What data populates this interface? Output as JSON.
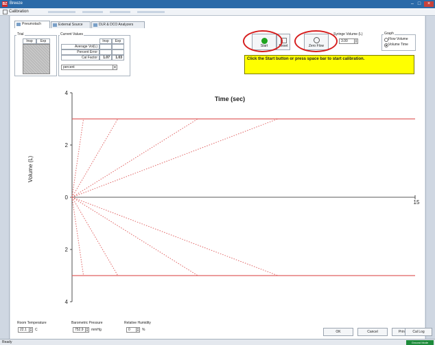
{
  "window": {
    "title": "Breeze",
    "logo": "BZ"
  },
  "menubar": {
    "label": "Calibration"
  },
  "tabs": [
    {
      "label": "Pneumotach",
      "icon": "pneumotach-icon"
    },
    {
      "label": "External Source",
      "icon": "external-source-icon"
    },
    {
      "label": "DLR & DCO Analyzers",
      "icon": "analyzer-icon"
    }
  ],
  "trial": {
    "label": "Trial",
    "insp": "Insp",
    "exp": "Exp"
  },
  "current_values": {
    "label": "Current Values",
    "insp": "Insp",
    "exp": "Exp",
    "rows": [
      {
        "name": "Average Vol(L)",
        "insp": "",
        "exp": ""
      },
      {
        "name": "Percent Error",
        "insp": "",
        "exp": ""
      },
      {
        "name": "Cal Factor",
        "insp": "1.07",
        "exp": "1.03"
      }
    ],
    "select_value": "percent"
  },
  "buttons": {
    "start": "Start",
    "reset": "Reset",
    "zero_flow": "Zero Flow",
    "ok": "OK",
    "cancel": "Cancel",
    "print": "Print",
    "cal_log": "Cal Log"
  },
  "syringe": {
    "label": "Syringe Volume (L)",
    "value": "3.00"
  },
  "graph_options": {
    "label": "Graph",
    "flow_volume": "Flow Volume",
    "volume_time": "Volume Time",
    "selected": "Volume Time"
  },
  "message": "Click the Start button or press space bar to start calibration.",
  "chart_data": {
    "type": "line",
    "title": "Time (sec)",
    "xlabel": "Time (sec)",
    "ylabel": "Volume (L)",
    "xlim": [
      0,
      15
    ],
    "ylim": [
      -4,
      4
    ],
    "y_ticks": [
      "4",
      "2",
      "0",
      "2",
      "4"
    ],
    "x_ticks": [
      "0",
      "15"
    ],
    "grid": false,
    "color": "#e06060",
    "target_lines": [
      3,
      -3
    ],
    "series_endpoints": [
      {
        "x": 0.5,
        "y": 3
      },
      {
        "x": 2.0,
        "y": 3
      },
      {
        "x": 5.5,
        "y": 3
      },
      {
        "x": 9.0,
        "y": 3
      },
      {
        "x": 0.5,
        "y": -3
      },
      {
        "x": 2.0,
        "y": -3
      },
      {
        "x": 5.5,
        "y": -3
      },
      {
        "x": 9.0,
        "y": -3
      }
    ]
  },
  "bottom_fields": {
    "room_temperature": {
      "label": "Room Temperature",
      "value": "22.1",
      "unit": "C"
    },
    "barometric_pressure": {
      "label": "Barometric Pressure",
      "value": "752.9",
      "unit": "mmHg"
    },
    "relative_humidity": {
      "label": "Relative Humidity",
      "value": "0",
      "unit": "%"
    }
  },
  "status": {
    "text": "Ready",
    "badge": "Ground Mode"
  }
}
